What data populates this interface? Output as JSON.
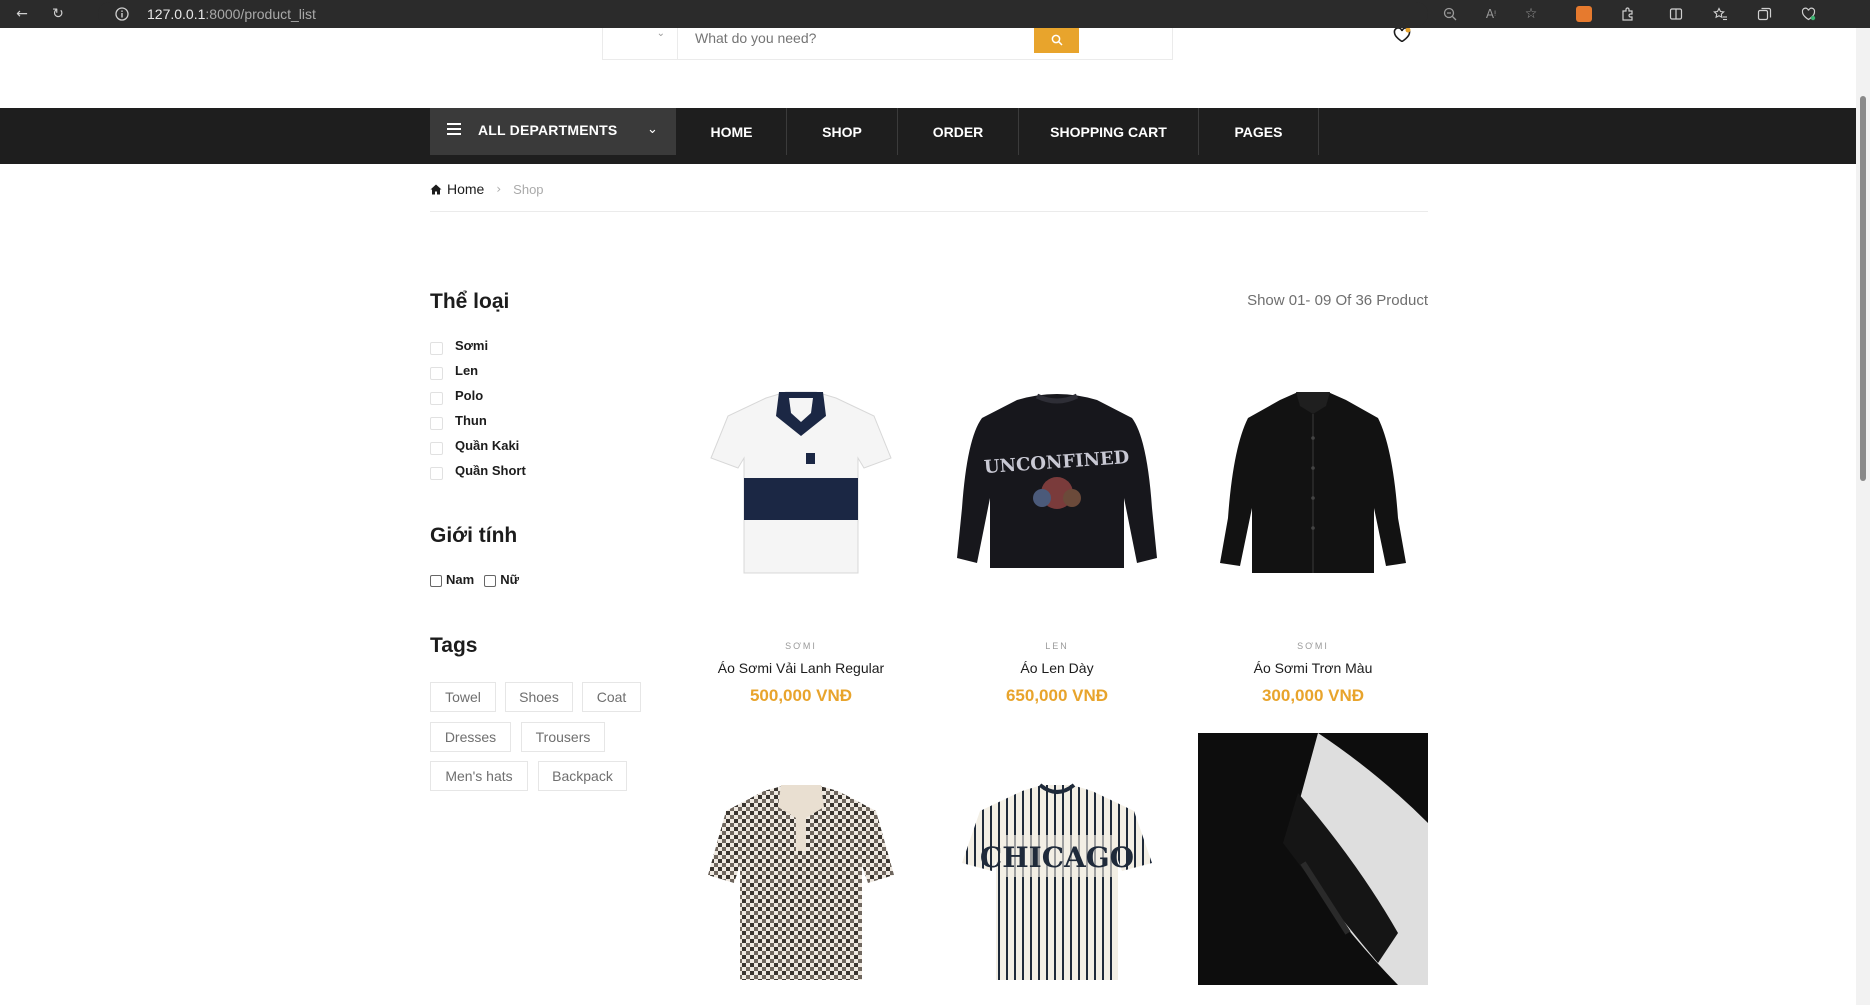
{
  "browser": {
    "url_host": "127.0.0.1",
    "url_rest": ":8000/product_list"
  },
  "header": {
    "search_placeholder": "What do you need?"
  },
  "nav": {
    "departments_label": "ALL DEPARTMENTS",
    "items": [
      "HOME",
      "SHOP",
      "ORDER",
      "SHOPPING CART",
      "PAGES"
    ]
  },
  "breadcrumb": {
    "home": "Home",
    "current": "Shop"
  },
  "sidebar": {
    "category_title": "Thể loại",
    "categories": [
      "Sơmi",
      "Len",
      "Polo",
      "Thun",
      "Quần Kaki",
      "Quần Short"
    ],
    "gender_title": "Giới tính",
    "genders": [
      "Nam",
      "Nữ"
    ],
    "tags_title": "Tags",
    "tags": [
      "Towel",
      "Shoes",
      "Coat",
      "Dresses",
      "Trousers",
      "Men's hats",
      "Backpack"
    ]
  },
  "products": {
    "show_count": "Show 01- 09 Of 36 Product",
    "items": [
      {
        "category": "SƠMI",
        "name": "Áo Sơmi Vải Lanh Regular",
        "price": "500,000 VNĐ"
      },
      {
        "category": "LEN",
        "name": "Áo Len Dày",
        "price": "650,000 VNĐ"
      },
      {
        "category": "SƠMI",
        "name": "Áo Sơmi Trơn Màu",
        "price": "300,000 VNĐ"
      }
    ],
    "image_print_text": [
      "UNCONFINED",
      "CHICAGO"
    ]
  },
  "colors": {
    "accent": "#e8a42c",
    "nav_bg": "#1e1e1e",
    "departments_bg": "#3a3a3a"
  }
}
